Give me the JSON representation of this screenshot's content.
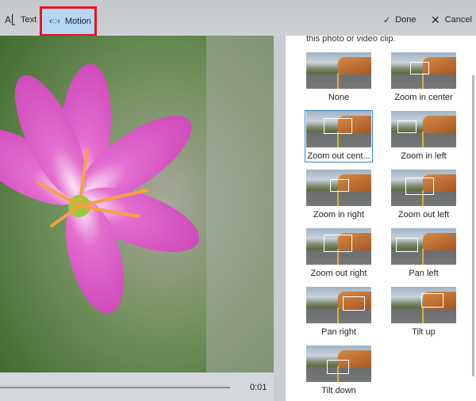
{
  "toolbar": {
    "text_label": "Text",
    "motion_label": "Motion",
    "done_label": "Done",
    "cancel_label": "Cancel"
  },
  "panel": {
    "intro": "this photo or video clip.",
    "options": [
      {
        "label": "None",
        "selected": false
      },
      {
        "label": "Zoom in center",
        "selected": false
      },
      {
        "label": "Zoom out cent...",
        "selected": true
      },
      {
        "label": "Zoom in left",
        "selected": false
      },
      {
        "label": "Zoom in right",
        "selected": false
      },
      {
        "label": "Zoom out left",
        "selected": false
      },
      {
        "label": "Zoom out right",
        "selected": false
      },
      {
        "label": "Pan left",
        "selected": false
      },
      {
        "label": "Pan right",
        "selected": false
      },
      {
        "label": "Tilt up",
        "selected": false
      },
      {
        "label": "Tilt down",
        "selected": false
      }
    ]
  },
  "timeline": {
    "time": "0:01"
  },
  "colors": {
    "highlight": "#e8121d",
    "selected": "#2f83d8"
  }
}
